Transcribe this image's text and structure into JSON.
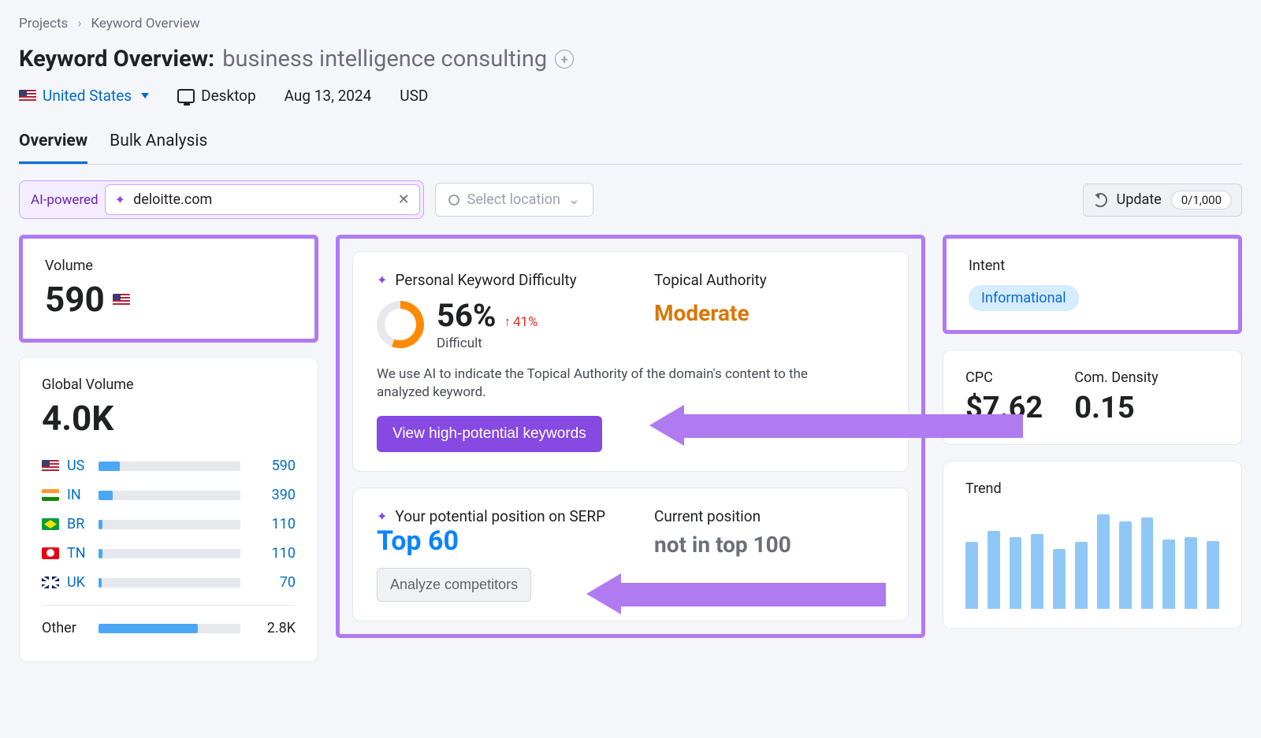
{
  "breadcrumb": {
    "root": "Projects",
    "page": "Keyword Overview"
  },
  "title": {
    "label": "Keyword Overview:",
    "keyword": "business intelligence consulting"
  },
  "meta": {
    "country": "United States",
    "device": "Desktop",
    "date": "Aug 13, 2024",
    "currency": "USD"
  },
  "tabs": [
    "Overview",
    "Bulk Analysis"
  ],
  "active_tab": 0,
  "controls": {
    "ai_label": "AI-powered",
    "domain_value": "deloitte.com",
    "location_placeholder": "Select location",
    "update_label": "Update",
    "update_count": "0/1,000"
  },
  "volume": {
    "label": "Volume",
    "value": "590"
  },
  "global_volume": {
    "label": "Global Volume",
    "value": "4.0K",
    "rows": [
      {
        "cc": "US",
        "val": "590",
        "pct": 15,
        "flag": "us"
      },
      {
        "cc": "IN",
        "val": "390",
        "pct": 10,
        "flag": "in"
      },
      {
        "cc": "BR",
        "val": "110",
        "pct": 3,
        "flag": "br"
      },
      {
        "cc": "TN",
        "val": "110",
        "pct": 3,
        "flag": "tn"
      },
      {
        "cc": "UK",
        "val": "70",
        "pct": 2,
        "flag": "uk"
      }
    ],
    "other": {
      "label": "Other",
      "val": "2.8K",
      "pct": 70
    }
  },
  "pkd": {
    "head": "Personal Keyword Difficulty",
    "value": "56%",
    "delta": "41%",
    "sub": "Difficult"
  },
  "ta": {
    "head": "Topical Authority",
    "value": "Moderate"
  },
  "ai_note": "We use AI to indicate the Topical Authority of the domain's content to the analyzed keyword.",
  "btn_primary": "View high-potential keywords",
  "pp": {
    "head": "Your potential position on SERP",
    "value": "Top 60",
    "cp_head": "Current position",
    "cp_value": "not in top 100",
    "analyze": "Analyze competitors"
  },
  "intent": {
    "label": "Intent",
    "value": "Informational"
  },
  "cpc": {
    "label": "CPC",
    "value": "$7.62"
  },
  "density": {
    "label": "Com. Density",
    "value": "0.15"
  },
  "trend": {
    "label": "Trend",
    "chart_data": {
      "type": "bar",
      "values": [
        70,
        82,
        75,
        78,
        63,
        70,
        99,
        92,
        96,
        73,
        75,
        71
      ]
    }
  }
}
